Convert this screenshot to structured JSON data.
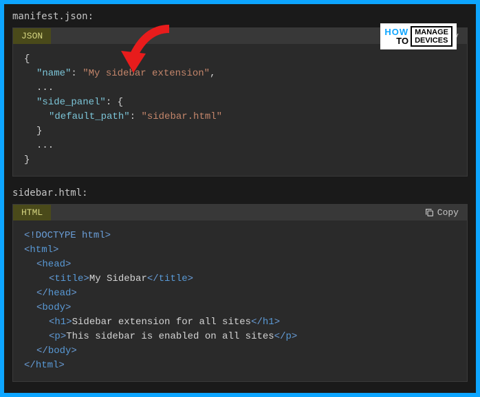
{
  "filenames": {
    "manifest": "manifest.json",
    "sidebar": "sidebar.html"
  },
  "block1": {
    "lang": "JSON",
    "copy_label": "Copy",
    "json": {
      "name_key": "\"name\"",
      "name_value": "\"My sidebar extension\"",
      "side_panel_key": "\"side_panel\"",
      "default_path_key": "\"default_path\"",
      "default_path_value": "\"sidebar.html\"",
      "ellipsis": "..."
    }
  },
  "block2": {
    "lang": "HTML",
    "copy_label": "Copy",
    "html_code": {
      "doctype": "!DOCTYPE html",
      "html_tag": "html",
      "head_tag": "head",
      "title_tag": "title",
      "title_text": "My Sidebar",
      "body_tag": "body",
      "h1_tag": "h1",
      "h1_text": "Sidebar extension for all sites",
      "p_tag": "p",
      "p_text": "This sidebar is enabled on all sites"
    }
  },
  "logo": {
    "how": "HOW",
    "to": "TO",
    "manage": "MANAGE",
    "devices": "DEVICES"
  }
}
